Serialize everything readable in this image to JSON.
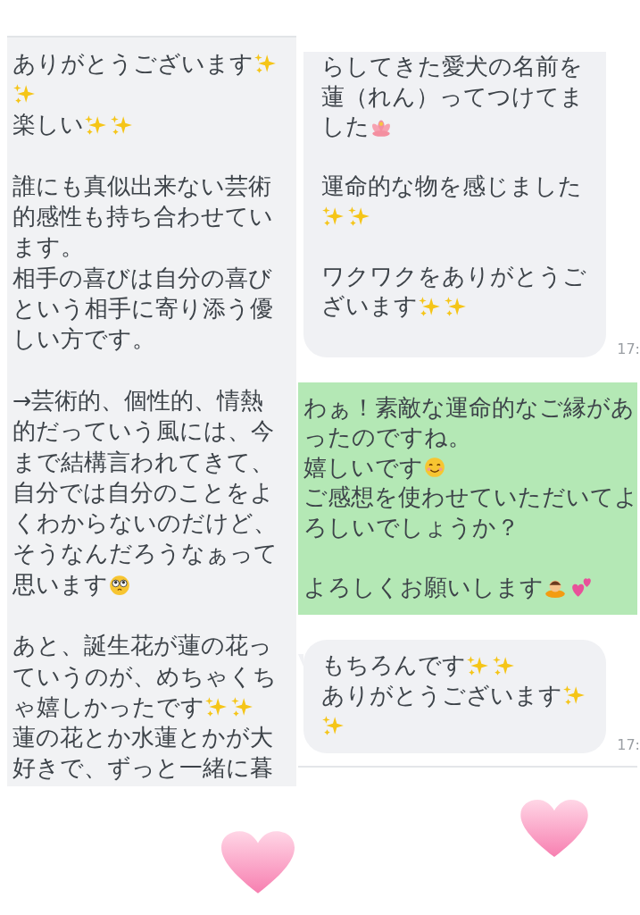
{
  "left_message": {
    "lines": [
      {
        "kind": "line",
        "text": "ありがとうございます",
        "emoji": [
          {
            "kind": "sparkles"
          }
        ]
      },
      {
        "kind": "line",
        "emoji": [
          {
            "kind": "sparkles"
          }
        ]
      },
      {
        "kind": "line",
        "text": "楽しい",
        "emoji": [
          {
            "kind": "sparkles"
          },
          {
            "kind": "sparkles"
          }
        ]
      },
      {
        "kind": "blank"
      },
      {
        "kind": "line",
        "text": "誰にも真似出来ない芸術"
      },
      {
        "kind": "line",
        "text": "的感性も持ち合わせてい"
      },
      {
        "kind": "line",
        "text": "ます。"
      },
      {
        "kind": "line",
        "text": "相手の喜びは自分の喜び"
      },
      {
        "kind": "line",
        "text": "という相手に寄り添う優"
      },
      {
        "kind": "line",
        "text": "しい方です。"
      },
      {
        "kind": "blank"
      },
      {
        "kind": "line",
        "text": "→芸術的、個性的、情熱"
      },
      {
        "kind": "line",
        "text": "的だっていう風には、今"
      },
      {
        "kind": "line",
        "text": "まで結構言われてきて、"
      },
      {
        "kind": "line",
        "text": "自分では自分のことをよ"
      },
      {
        "kind": "line",
        "text": "くわからないのだけど、"
      },
      {
        "kind": "line",
        "text": "そうなんだろうなぁって"
      },
      {
        "kind": "line",
        "text": "思います",
        "emoji": [
          {
            "kind": "pleading"
          }
        ]
      },
      {
        "kind": "blank"
      },
      {
        "kind": "line",
        "text": "あと、誕生花が蓮の花っ"
      },
      {
        "kind": "line",
        "text": "ていうのが、めちゃくち"
      },
      {
        "kind": "line",
        "text": "ゃ嬉しかったです",
        "emoji": [
          {
            "kind": "sparkles"
          },
          {
            "kind": "sparkles"
          }
        ]
      },
      {
        "kind": "line",
        "text": "蓮の花とか水蓮とかが大"
      },
      {
        "kind": "line",
        "text": "好きで、ずっと一緒に暮"
      }
    ]
  },
  "right_messages": [
    {
      "kind": "received",
      "time": "17:",
      "lines": [
        {
          "kind": "line",
          "text": "らしてきた愛犬の名前を"
        },
        {
          "kind": "line",
          "text": "蓮（れん）ってつけてま"
        },
        {
          "kind": "line",
          "text": "した",
          "emoji": [
            {
              "kind": "lotus"
            }
          ]
        },
        {
          "kind": "blank"
        },
        {
          "kind": "line",
          "text": "運命的な物を感じました"
        },
        {
          "kind": "line",
          "emoji": [
            {
              "kind": "sparkles"
            },
            {
              "kind": "sparkles"
            }
          ]
        },
        {
          "kind": "blank"
        },
        {
          "kind": "line",
          "text": "ワクワクをありがとうご"
        },
        {
          "kind": "line",
          "text": "ざいます",
          "emoji": [
            {
              "kind": "sparkles"
            },
            {
              "kind": "sparkles"
            }
          ]
        }
      ]
    },
    {
      "kind": "sent",
      "lines": [
        {
          "kind": "line",
          "text": "わぁ！素敵な運命的なご縁があ"
        },
        {
          "kind": "line",
          "text": "ったのですね。"
        },
        {
          "kind": "line",
          "text": "嬉しいです",
          "emoji": [
            {
              "kind": "smile"
            }
          ]
        },
        {
          "kind": "line",
          "text": "ご感想を使わせていただいてよ"
        },
        {
          "kind": "line",
          "text": "ろしいでしょうか？"
        },
        {
          "kind": "blank"
        },
        {
          "kind": "line",
          "text": "よろしくお願いします",
          "emoji": [
            {
              "kind": "bow"
            },
            {
              "kind": "hearts"
            }
          ]
        }
      ]
    },
    {
      "kind": "received",
      "time": "17:",
      "lines": [
        {
          "kind": "line",
          "text": "もちろんです",
          "emoji": [
            {
              "kind": "sparkles"
            },
            {
              "kind": "sparkles"
            }
          ]
        },
        {
          "kind": "line",
          "text": "ありがとうございます",
          "emoji": [
            {
              "kind": "sparkles"
            }
          ]
        },
        {
          "kind": "line",
          "emoji": [
            {
              "kind": "sparkles"
            }
          ]
        }
      ]
    }
  ]
}
